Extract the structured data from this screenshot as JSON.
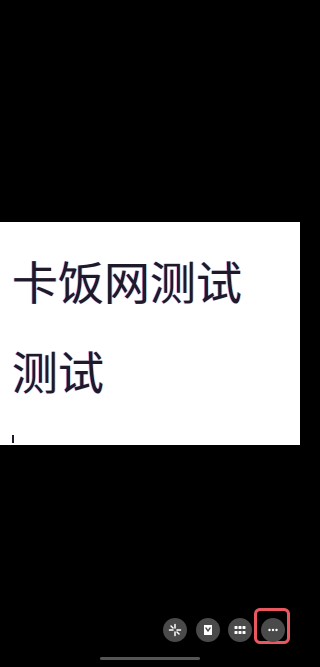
{
  "image_viewer": {
    "lines": [
      "卡饭网测试",
      "测试"
    ]
  },
  "toolbar": {
    "buttons": [
      {
        "icon": "sparkle-icon"
      },
      {
        "icon": "download-icon"
      },
      {
        "icon": "grid-icon"
      },
      {
        "icon": "more-icon",
        "highlighted": true
      }
    ]
  },
  "colors": {
    "background": "#000000",
    "panel": "#ffffff",
    "text": "#1e1a2a",
    "button": "#4a4a4a",
    "highlight": "#e8585e"
  }
}
